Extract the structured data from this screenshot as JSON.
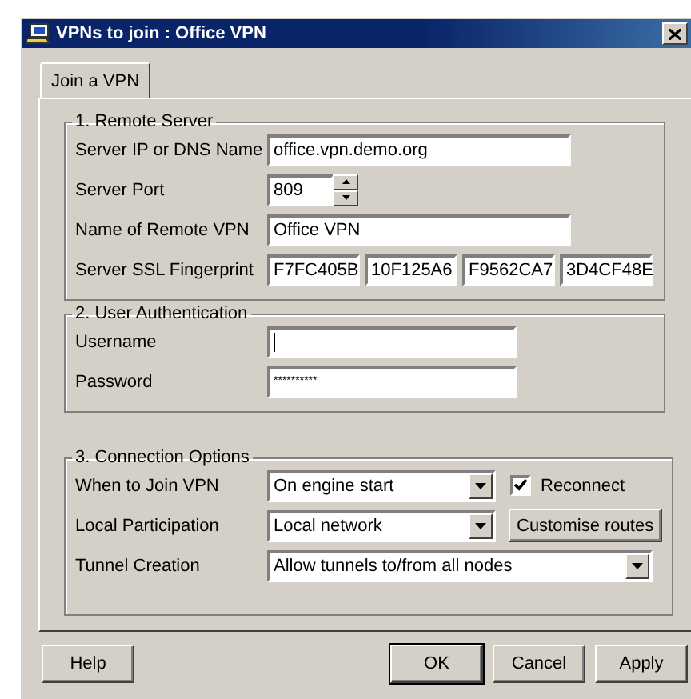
{
  "window": {
    "title": "VPNs to join : Office VPN"
  },
  "tabs": [
    {
      "label": "Join a VPN",
      "selected": true
    }
  ],
  "groups": [
    {
      "title": "1. Remote Server",
      "rows": [
        {
          "kind": "text",
          "label": "Server IP or DNS Name",
          "value": "office.vpn.demo.org"
        },
        {
          "kind": "spin",
          "label": "Server Port",
          "value": "809"
        },
        {
          "kind": "text",
          "label": "Name of Remote VPN",
          "value": "Office VPN"
        },
        {
          "kind": "multi",
          "label": "Server SSL Fingerprint",
          "values": [
            "F7FC405B",
            "10F125A6",
            "F9562CA7",
            "3D4CF48E"
          ]
        }
      ]
    },
    {
      "title": "2. User Authentication",
      "rows": [
        {
          "kind": "short",
          "label": "Username",
          "value": "",
          "focused": true
        },
        {
          "kind": "short",
          "label": "Password",
          "value": "**********",
          "focused": false
        }
      ]
    },
    {
      "title": "3. Connection Options",
      "rows": [
        {
          "kind": "combo",
          "label": "When to Join VPN",
          "value": "On engine start",
          "checkbox": {
            "label": "Reconnect",
            "checked": true
          }
        },
        {
          "kind": "combo",
          "label": "Local Participation",
          "value": "Local network",
          "button": "Customise routes"
        },
        {
          "kind": "wide-combo",
          "label": "Tunnel Creation",
          "value": "Allow tunnels to/from all nodes"
        }
      ]
    }
  ],
  "buttons": [
    {
      "label": "Help",
      "default": false
    },
    {
      "label": "OK",
      "default": true
    },
    {
      "label": "Cancel",
      "default": false
    },
    {
      "label": "Apply",
      "default": false
    }
  ]
}
